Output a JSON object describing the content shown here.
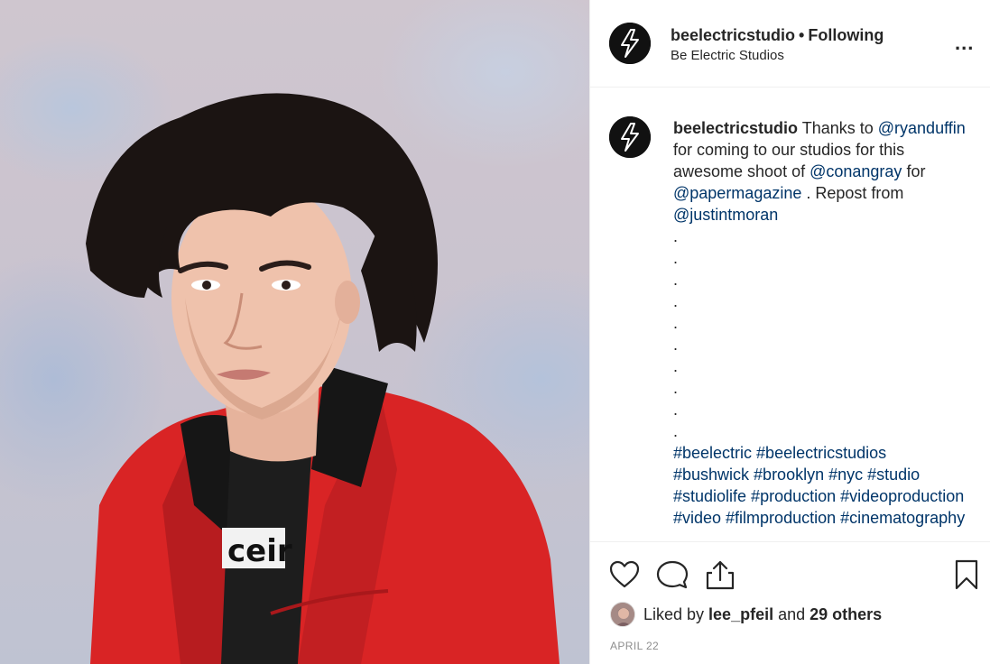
{
  "photo": {
    "alt_icon": "portrait-photo"
  },
  "header": {
    "username": "beelectricstudio",
    "separator": "•",
    "follow_state": "Following",
    "subtitle": "Be Electric Studios",
    "more_icon": "more-options-icon",
    "more_label": "..."
  },
  "caption": {
    "username": "beelectricstudio",
    "segments": [
      " Thanks to ",
      "@ryanduffin",
      " for coming to our studios for this awesome shoot of ",
      "@conangray",
      " for ",
      "@papermagazine",
      " . Repost from ",
      "@justintmoran"
    ],
    "dots": [
      ".",
      ".",
      ".",
      ".",
      ".",
      ".",
      ".",
      ".",
      ".",
      "."
    ],
    "hashtags": "#beelectric #beelectricstudios #bushwick #brooklyn #nyc #studio #studiolife #production #videoproduction #video #filmproduction #cinematography"
  },
  "actions": {
    "like_icon": "heart-icon",
    "comment_icon": "comment-icon",
    "share_icon": "share-icon",
    "save_icon": "bookmark-icon"
  },
  "likes": {
    "prefix": "Liked by ",
    "user": "lee_pfeil",
    "middle": " and ",
    "others": "29 others"
  },
  "date": "APRIL 22",
  "colors": {
    "link": "#003569",
    "text": "#262626",
    "muted": "#8e8e8e",
    "border": "#efefef"
  }
}
